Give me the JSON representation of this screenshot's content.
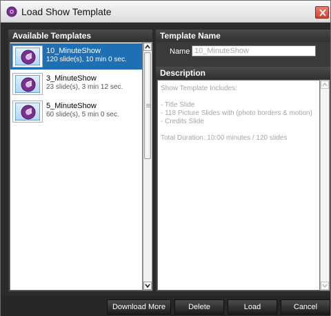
{
  "window": {
    "title": "Load Show Template",
    "icon": "music-disc-icon",
    "close_icon": "close-icon"
  },
  "left_panel": {
    "header": "Available Templates",
    "templates": [
      {
        "name": "10_MinuteShow",
        "meta": "120 slide(s), 10 min 0 sec.",
        "selected": true
      },
      {
        "name": "3_MinuteShow",
        "meta": "23 slide(s), 3 min 12 sec.",
        "selected": false
      },
      {
        "name": "5_MinuteShow",
        "meta": "60 slide(s), 5 min 0 sec.",
        "selected": false
      }
    ]
  },
  "right_panel": {
    "name_header": "Template Name",
    "name_label": "Name",
    "name_value": "10_MinuteShow",
    "description_header": "Description",
    "description_text": "Show Template Includes:\n\n- Title Slide\n- 118 Picture Slides with (photo borders & motion)\n- Credits Slide\n\nTotal Duration: 10:00 minutes / 120 slides"
  },
  "footer": {
    "download_more": "Download More",
    "delete": "Delete",
    "load": "Load",
    "cancel": "Cancel"
  },
  "colors": {
    "selection": "#1f6fb5",
    "panel_bg": "#3a3a3a",
    "footer_bg": "#262626",
    "close_red": "#d0402d"
  }
}
